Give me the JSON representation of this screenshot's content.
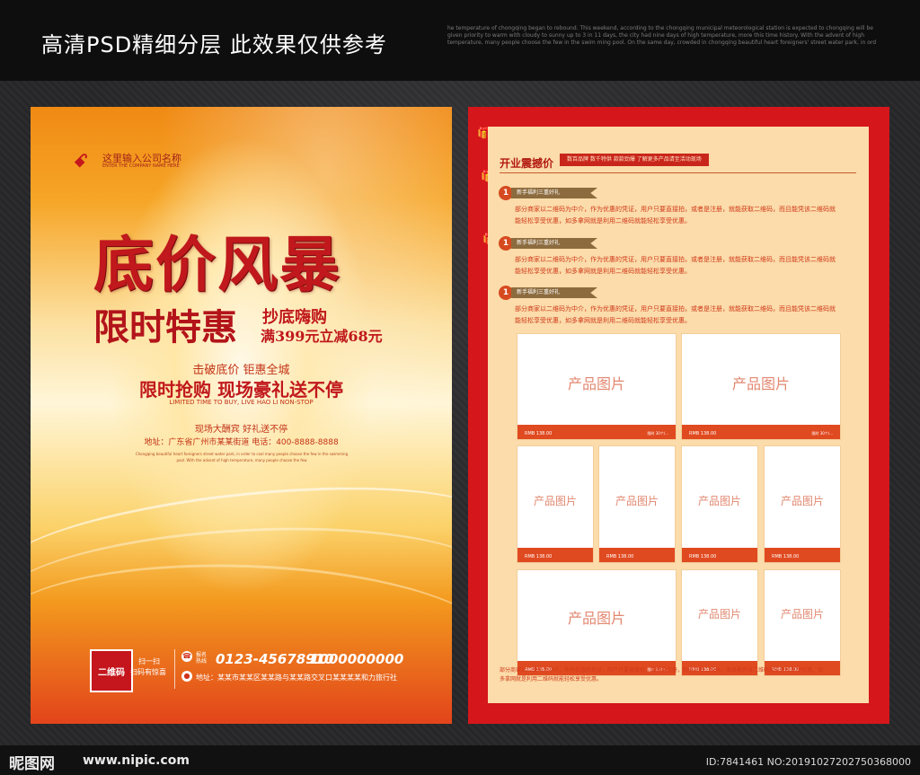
{
  "topbar": {
    "title": "高清PSD精细分层 此效果仅供参考",
    "desc": "he temperature of chongqing began to rebound. This weekend, according to the chongqing municipal meteorological station is expected to chongqing will be given priority to warm with cloudy to sunny up to 3 in 11 days, the city had nine days of high temperature, more this time history. With the advent of high temperature, many people choose the few in the swim ming pool. On the same day, crowded in chongqing beautiful heart foreigners' street water park, in ord"
  },
  "left": {
    "company_mark": "ꗃ",
    "company_name": "这里输入公司名称",
    "company_en": "ENTER THE COMPANY NAME HERE",
    "headline": "底价风暴",
    "subhead": "限时特惠",
    "promo_line1": "抄底嗨购",
    "promo_line2": "满399元立减68元",
    "tagline1": "击破底价 钜惠全城",
    "tagline2": "限时抢购 现场豪礼送不停",
    "tagline2_en": "LIMITED TIME TO BUY, LIVE HAO LI NON-STOP",
    "tagline3": "现场大酬宾 好礼送不停",
    "address_line": "地址：广东省广州市某某街道 电话：400-8888-8888",
    "fine_print": "Chongqing beautiful heart foreigners street water park, in order to cool many people choose the few in the swimming pool. With the advent of high temperature, many people choose the few",
    "qr_label": "二维码",
    "scan_1": "扫一扫",
    "scan_2": "扫码有惊喜",
    "hotline_label": "报名热线",
    "phone1": "0123-45678910",
    "phone2": "1000000000",
    "bottom_address": "地址：某某市某某区某某路与某某路交叉口某某某某和力旅行社"
  },
  "right": {
    "header_title": "开业震撼价",
    "header_pill": "数百品牌  数千特供  款款劲爆  了解更多产品请至活动现场",
    "steps": [
      {
        "num": "1",
        "ribbon": "新手福利三重好礼",
        "body": "部分商家以二维码为中介，作为优惠的凭证，用户只要直接拍，或者是注册，就能获取二维码，而且能凭该二维码就能轻松享受优惠，如多拿网就是利用二维码就能轻松享受优惠。"
      },
      {
        "num": "1",
        "ribbon": "新手福利三重好礼",
        "body": "部分商家以二维码为中介，作为优惠的凭证，用户只要直接拍，或者是注册，就能获取二维码，而且能凭该二维码就能轻松享受优惠，如多拿网就是利用二维码就能轻松享受优惠。"
      },
      {
        "num": "1",
        "ribbon": "新手福利三重好礼",
        "body": "部分商家以二维码为中介，作为优惠的凭证，用户只要直接拍，或者是注册，就能获取二维码，而且能凭该二维码就能轻松享受优惠，如多拿网就是利用二维码就能轻松享受优惠。"
      }
    ],
    "product_label": "产品图片",
    "price": "RMB 138.00",
    "price_note": "限时 30个/...",
    "footer": "部分商家以二维码为中介，作为优惠的凭证，用户只要直接拍，或者是注册，就能获取二维码，而且能凭该二维码就能轻松享受优惠，如多拿网就是利用二维码就能轻松享受优惠。"
  },
  "bottombar": {
    "logo": "昵图网",
    "url": "www.nipic.com",
    "id_text": "ID:7841461 NO:20191027202750368000"
  },
  "colors": {
    "brand_red": "#c0181c",
    "panel_beige": "#fbdcaa",
    "accent_orange": "#e04a20"
  }
}
